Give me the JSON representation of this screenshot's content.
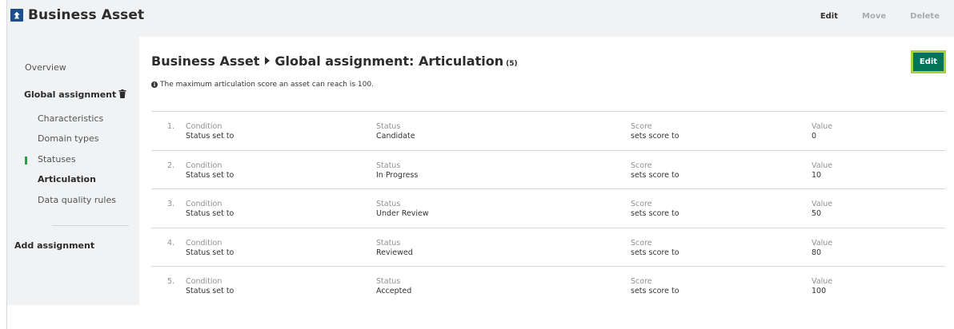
{
  "header": {
    "title": "Business Asset",
    "actions": {
      "edit": "Edit",
      "move": "Move",
      "delete": "Delete"
    }
  },
  "sidebar": {
    "overview": "Overview",
    "global_assignment": "Global assignment",
    "items": [
      "Characteristics",
      "Domain types",
      "Statuses",
      "Articulation",
      "Data quality rules"
    ],
    "active_item": "Articulation",
    "add_assignment": "Add assignment"
  },
  "main": {
    "breadcrumb_parent": "Business Asset",
    "breadcrumb_current": "Global assignment: Articulation",
    "count": "(5)",
    "edit_label": "Edit",
    "info_text": "The maximum articulation score an asset can reach is 100.",
    "rows": [
      {
        "num": "1.",
        "cond_label": "Condition",
        "cond_value": "Status set to",
        "status_label": "Status",
        "status_value": "Candidate",
        "score_label": "Score",
        "score_value": "sets score to",
        "value_label": "Value",
        "value": "0"
      },
      {
        "num": "2.",
        "cond_label": "Condition",
        "cond_value": "Status set to",
        "status_label": "Status",
        "status_value": "In Progress",
        "score_label": "Score",
        "score_value": "sets score to",
        "value_label": "Value",
        "value": "10"
      },
      {
        "num": "3.",
        "cond_label": "Condition",
        "cond_value": "Status set to",
        "status_label": "Status",
        "status_value": "Under Review",
        "score_label": "Score",
        "score_value": "sets score to",
        "value_label": "Value",
        "value": "50"
      },
      {
        "num": "4.",
        "cond_label": "Condition",
        "cond_value": "Status set to",
        "status_label": "Status",
        "status_value": "Reviewed",
        "score_label": "Score",
        "score_value": "sets score to",
        "value_label": "Value",
        "value": "80"
      },
      {
        "num": "5.",
        "cond_label": "Condition",
        "cond_value": "Status set to",
        "status_label": "Status",
        "status_value": "Accepted",
        "score_label": "Score",
        "score_value": "sets score to",
        "value_label": "Value",
        "value": "100"
      }
    ]
  },
  "colors": {
    "brand_icon": "#1b4e8f",
    "primary_button": "#00755a",
    "focus_ring": "#a8d334",
    "active_marker": "#25a244",
    "sidebar_bg": "#f0f2f4"
  },
  "icons": {
    "app": "business-asset-icon",
    "delete_assignment": "trash-icon",
    "info": "info-icon"
  }
}
